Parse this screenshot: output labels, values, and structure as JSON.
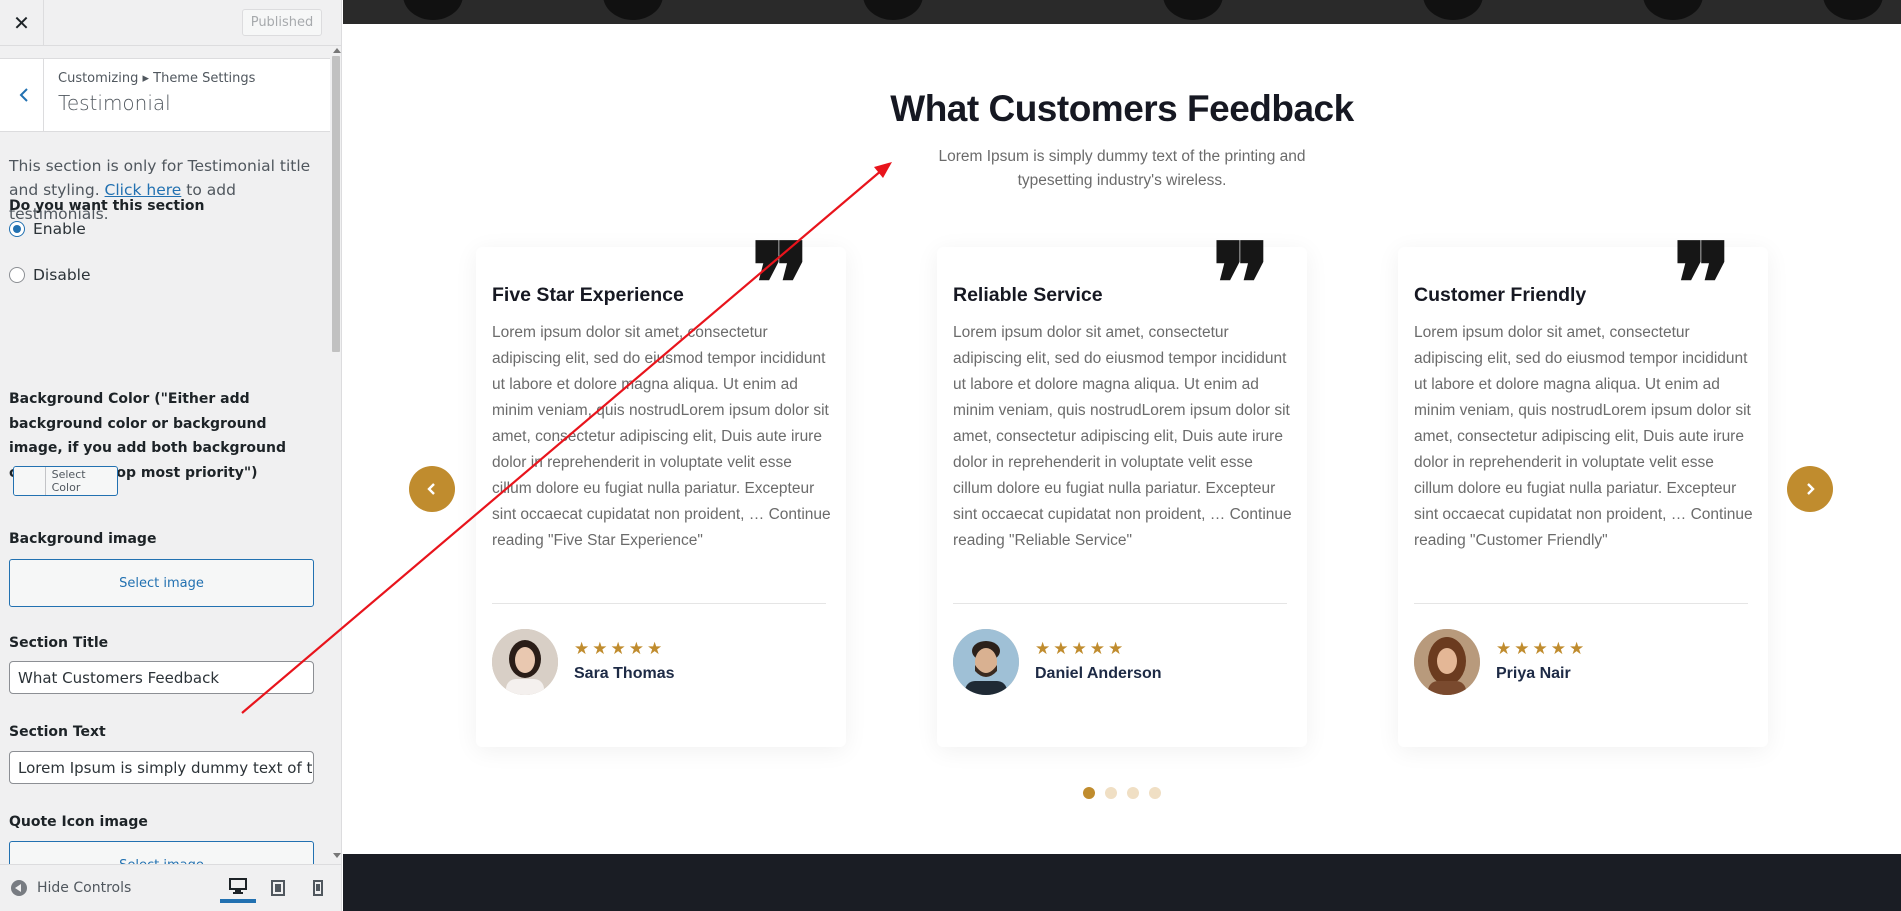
{
  "customizer": {
    "close_label": "✕",
    "published_label": "Published",
    "breadcrumb": "Customizing ▸ Theme Settings",
    "panel_title": "Testimonial",
    "description_before": "This section is only for Testimonial title and styling. ",
    "description_link": "Click here",
    "description_after": " to add testimonials.",
    "section_toggle": {
      "label": "Do you want this section",
      "options": [
        "Enable",
        "Disable"
      ],
      "selected": "Enable"
    },
    "background_color": {
      "label": "Background Color (\"Either add background color or background image, if you add both background color will be top most priority\")",
      "button_label": "Select Color"
    },
    "background_image": {
      "label": "Background image",
      "button_label": "Select image"
    },
    "section_title": {
      "label": "Section Title",
      "value": "What Customers Feedback"
    },
    "section_text": {
      "label": "Section Text",
      "value": "Lorem Ipsum is simply dummy text of the"
    },
    "quote_icon": {
      "label": "Quote Icon image",
      "button_label": "Select image"
    },
    "footer": {
      "hide_controls": "Hide Controls",
      "devices": [
        "desktop-icon",
        "tablet-icon",
        "mobile-icon"
      ],
      "active_device": "desktop"
    }
  },
  "preview": {
    "title": "What Customers Feedback",
    "text": "Lorem Ipsum is simply dummy text of the printing and typesetting industry's wireless.",
    "quote_glyph": "❞",
    "prev_arrow": "‹",
    "next_arrow": "›",
    "cards": [
      {
        "title": "Five Star Experience",
        "body": "Lorem ipsum dolor sit amet, consectetur adipiscing elit, sed do eiusmod tempor incididunt ut labore et dolore magna aliqua. Ut enim ad minim veniam, quis nostrudLorem ipsum dolor sit amet, consectetur adipiscing elit, Duis aute irure dolor in reprehenderit in voluptate velit esse cillum dolore eu fugiat nulla pariatur. Excepteur sint occaecat cupidatat non proident, … Continue reading \"Five Star Experience\"",
        "stars": "★★★★★",
        "name": "Sara Thomas"
      },
      {
        "title": "Reliable Service",
        "body": "Lorem ipsum dolor sit amet, consectetur adipiscing elit, sed do eiusmod tempor incididunt ut labore et dolore magna aliqua. Ut enim ad minim veniam, quis nostrudLorem ipsum dolor sit amet, consectetur adipiscing elit, Duis aute irure dolor in reprehenderit in voluptate velit esse cillum dolore eu fugiat nulla pariatur. Excepteur sint occaecat cupidatat non proident, … Continue reading \"Reliable Service\"",
        "stars": "★★★★★",
        "name": "Daniel Anderson"
      },
      {
        "title": "Customer Friendly",
        "body": "Lorem ipsum dolor sit amet, consectetur adipiscing elit, sed do eiusmod tempor incididunt ut labore et dolore magna aliqua. Ut enim ad minim veniam, quis nostrudLorem ipsum dolor sit amet, consectetur adipiscing elit, Duis aute irure dolor in reprehenderit in voluptate velit esse cillum dolore eu fugiat nulla pariatur. Excepteur sint occaecat cupidatat non proident, … Continue reading \"Customer Friendly\"",
        "stars": "★★★★★",
        "name": "Priya Nair"
      }
    ],
    "pagination": {
      "total": 4,
      "active": 1
    }
  },
  "colors": {
    "accent_gold": "#c08c2e",
    "wp_blue": "#2271b1",
    "annotation_arrow": "#e8141c"
  }
}
